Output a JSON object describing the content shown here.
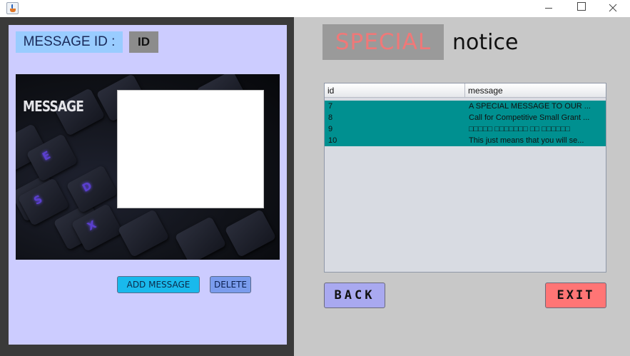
{
  "window": {
    "buttons": {
      "minimize": "minimize",
      "maximize": "maximize",
      "close": "close"
    }
  },
  "left": {
    "message_id_label": "MESSAGE ID :",
    "message_id_value": "ID",
    "message_caption": "MESSAGE",
    "message_input_value": "",
    "add_button": "ADD MESSAGE",
    "delete_button": "DELETE",
    "keyboard_keys": [
      "E",
      "D",
      "S",
      "X"
    ]
  },
  "right": {
    "special_label": "SPECIAL",
    "notice_label": "notice",
    "table": {
      "columns": [
        "id",
        "message"
      ],
      "rows": [
        {
          "id": "7",
          "message": "A SPECIAL MESSAGE TO OUR ..."
        },
        {
          "id": "8",
          "message": "Call for Competitive Small Grant ..."
        },
        {
          "id": "9",
          "message": "□□□□□ □□□□□□□ □□ □□□□□□"
        },
        {
          "id": "10",
          "message": "This just means that you will se..."
        }
      ]
    },
    "back_button": "BACK",
    "exit_button": "EXIT"
  },
  "colors": {
    "selected_row": "#009090",
    "special_text": "#f07878",
    "exit_button": "#ff7575",
    "back_button": "#a9a9f0",
    "add_button": "#19b9ec"
  }
}
